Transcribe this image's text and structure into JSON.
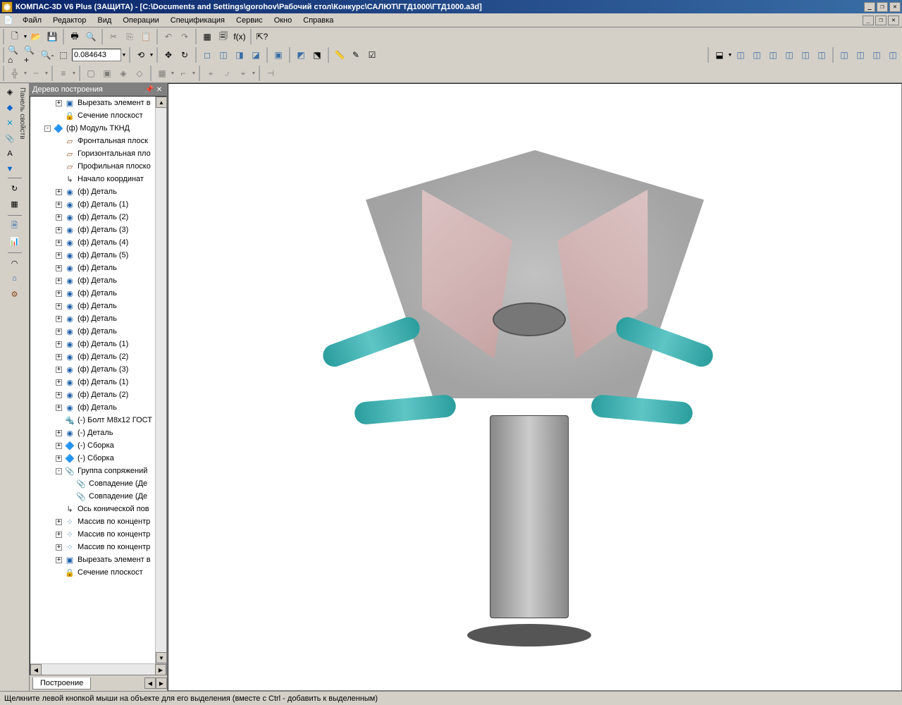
{
  "title": "КОМПАС-3D V6 Plus (ЗАЩИТА) - [C:\\Documents and Settings\\gorohov\\Рабочий стол\\Конкурс\\САЛЮТ\\ГТД1000\\ГТД1000.a3d]",
  "menu": {
    "items": [
      "Файл",
      "Редактор",
      "Вид",
      "Операции",
      "Спецификация",
      "Сервис",
      "Окно",
      "Справка"
    ]
  },
  "zoom": {
    "value": "0.084643"
  },
  "tree": {
    "header": "Дерево построения",
    "tab": "Построение",
    "nodes": [
      {
        "indent": 1,
        "exp": "+",
        "icon": "cut",
        "label": "Вырезать элемент в"
      },
      {
        "indent": 1,
        "exp": "",
        "icon": "sec",
        "label": "Сечение плоскост"
      },
      {
        "indent": 0,
        "exp": "-",
        "icon": "asm",
        "label": "(ф) Модуль ТКНД"
      },
      {
        "indent": 1,
        "exp": "",
        "icon": "plane",
        "label": "Фронтальная плоск"
      },
      {
        "indent": 1,
        "exp": "",
        "icon": "plane",
        "label": "Горизонтальная пло"
      },
      {
        "indent": 1,
        "exp": "",
        "icon": "plane",
        "label": "Профильная плоско"
      },
      {
        "indent": 1,
        "exp": "",
        "icon": "axis",
        "label": "Начало координат"
      },
      {
        "indent": 1,
        "exp": "+",
        "icon": "part",
        "label": "(ф) Деталь"
      },
      {
        "indent": 1,
        "exp": "+",
        "icon": "part",
        "label": "(ф) Деталь (1)"
      },
      {
        "indent": 1,
        "exp": "+",
        "icon": "part",
        "label": "(ф) Деталь (2)"
      },
      {
        "indent": 1,
        "exp": "+",
        "icon": "part",
        "label": "(ф) Деталь (3)"
      },
      {
        "indent": 1,
        "exp": "+",
        "icon": "part",
        "label": "(ф) Деталь (4)"
      },
      {
        "indent": 1,
        "exp": "+",
        "icon": "part",
        "label": "(ф) Деталь (5)"
      },
      {
        "indent": 1,
        "exp": "+",
        "icon": "part",
        "label": "(ф) Деталь"
      },
      {
        "indent": 1,
        "exp": "+",
        "icon": "part",
        "label": "(ф) Деталь"
      },
      {
        "indent": 1,
        "exp": "+",
        "icon": "part",
        "label": "(ф) Деталь"
      },
      {
        "indent": 1,
        "exp": "+",
        "icon": "part",
        "label": "(ф) Деталь"
      },
      {
        "indent": 1,
        "exp": "+",
        "icon": "part",
        "label": "(ф) Деталь"
      },
      {
        "indent": 1,
        "exp": "+",
        "icon": "part",
        "label": "(ф) Деталь"
      },
      {
        "indent": 1,
        "exp": "+",
        "icon": "part",
        "label": "(ф) Деталь (1)"
      },
      {
        "indent": 1,
        "exp": "+",
        "icon": "part",
        "label": "(ф) Деталь (2)"
      },
      {
        "indent": 1,
        "exp": "+",
        "icon": "part",
        "label": "(ф) Деталь (3)"
      },
      {
        "indent": 1,
        "exp": "+",
        "icon": "part",
        "label": "(ф) Деталь (1)"
      },
      {
        "indent": 1,
        "exp": "+",
        "icon": "part",
        "label": "(ф) Деталь (2)"
      },
      {
        "indent": 1,
        "exp": "+",
        "icon": "part",
        "label": "(ф) Деталь"
      },
      {
        "indent": 1,
        "exp": "",
        "icon": "bolt",
        "label": "(-) Болт М8х12 ГОСТ"
      },
      {
        "indent": 1,
        "exp": "+",
        "icon": "part",
        "label": "(-) Деталь"
      },
      {
        "indent": 1,
        "exp": "+",
        "icon": "asm",
        "label": "(-) Сборка"
      },
      {
        "indent": 1,
        "exp": "+",
        "icon": "asm",
        "label": "(-) Сборка"
      },
      {
        "indent": 1,
        "exp": "-",
        "icon": "mate",
        "label": "Группа сопряжений"
      },
      {
        "indent": 2,
        "exp": "",
        "icon": "mate",
        "label": "Совпадение (Де"
      },
      {
        "indent": 2,
        "exp": "",
        "icon": "mate",
        "label": "Совпадение (Де"
      },
      {
        "indent": 1,
        "exp": "",
        "icon": "axis",
        "label": "Ось конической пов"
      },
      {
        "indent": 1,
        "exp": "+",
        "icon": "arr",
        "label": "Массив по концентр"
      },
      {
        "indent": 1,
        "exp": "+",
        "icon": "arr",
        "label": "Массив по концентр"
      },
      {
        "indent": 1,
        "exp": "+",
        "icon": "arr",
        "label": "Массив по концентр"
      },
      {
        "indent": 1,
        "exp": "+",
        "icon": "cut",
        "label": "Вырезать элемент в"
      },
      {
        "indent": 1,
        "exp": "",
        "icon": "sec",
        "label": "Сечение плоскост"
      }
    ]
  },
  "sidebar": {
    "label": "Панель свойств"
  },
  "status": {
    "text": "Щелкните левой кнопкой мыши на объекте для его выделения (вместе с Ctrl - добавить к выделенным)"
  }
}
